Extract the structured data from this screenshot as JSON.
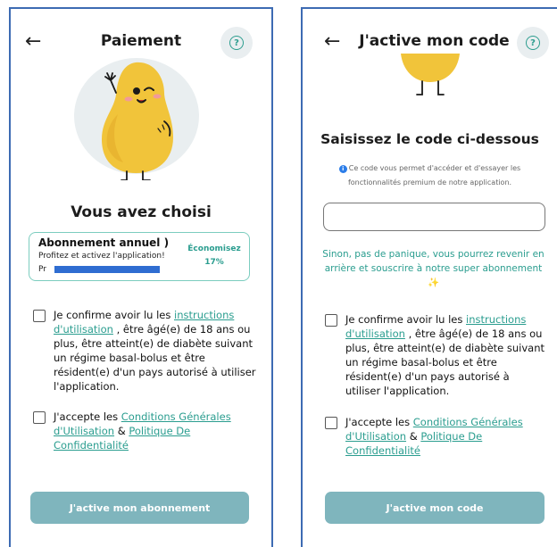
{
  "left": {
    "title": "Paiement",
    "back_arrow": "←",
    "help_glyph": "?",
    "heading": "Vous avez choisi",
    "plan": {
      "name": "Abonnement annuel )",
      "subtitle": "Profitez et activez l'application!",
      "price_prefix": "Pr",
      "savings_label": "Économisez",
      "savings_value": "17%"
    },
    "consent_1": {
      "prefix": "Je confirme avoir lu les ",
      "link": "instructions d'utilisation",
      "suffix": " , être âgé(e) de 18 ans ou plus, être atteint(e) de diabète suivant un régime basal-bolus et être résident(e) d'un pays autorisé à utiliser l'application."
    },
    "consent_2": {
      "prefix": "J'accepte les ",
      "link_1": "Conditions Générales d'Utilisation",
      "middle": " & ",
      "link_2": "Politique De Confidentialité"
    },
    "cta_label": "J'active mon abonnement"
  },
  "right": {
    "title": "J'active mon code",
    "back_arrow": "←",
    "help_glyph": "?",
    "heading": "Saisissez le code ci-dessous",
    "info_icon": "i",
    "info_line_1": "Ce code vous permet d'accéder et d'essayer les",
    "info_line_2": "fonctionnalités premium de notre application.",
    "code_value": "",
    "fallback_message": "Sinon, pas de panique, vous pourrez revenir en arrière et souscrire à notre super abonnement ✨",
    "consent_1": {
      "prefix": "Je confirme avoir lu les ",
      "link": "instructions d'utilisation",
      "suffix": " , être âgé(e) de 18 ans ou plus, être atteint(e) de diabète suivant un régime basal-bolus et être résident(e) d'un pays autorisé à utiliser l'application."
    },
    "consent_2": {
      "prefix": "J'accepte les ",
      "link_1": "Conditions Générales d'Utilisation",
      "middle": " & ",
      "link_2": "Politique De Confidentialité"
    },
    "cta_label": "J'active mon code"
  },
  "colors": {
    "accent": "#2a9d8f",
    "button": "#7fb5bd",
    "mascot_body": "#f1c43a",
    "mascot_bg": "#e9eef0",
    "frame": "#3d6bb3"
  }
}
